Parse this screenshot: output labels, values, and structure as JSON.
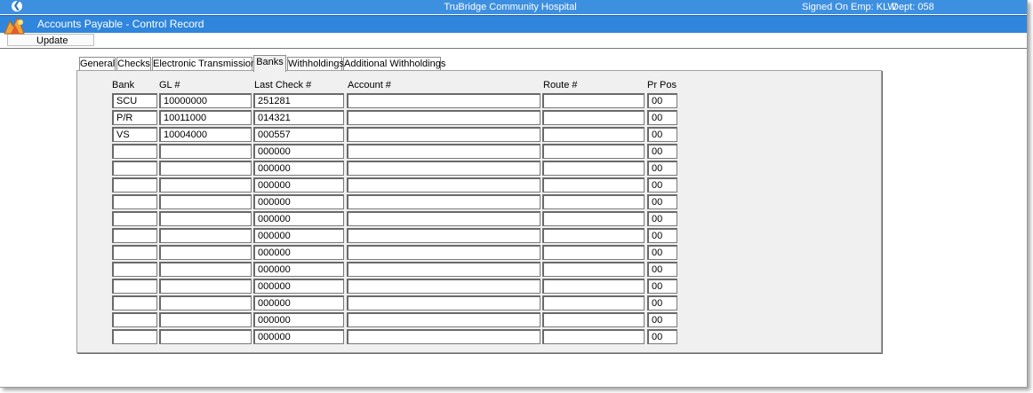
{
  "top_bar": {
    "hospital": "TruBridge Community Hospital",
    "signon": "Signed On Emp: KLW",
    "dept": "Dept: 058"
  },
  "title_bar": {
    "title": "Accounts Payable - Control Record"
  },
  "menu": {
    "update_label": "Update"
  },
  "tabs": [
    {
      "label": "General"
    },
    {
      "label": "Checks"
    },
    {
      "label": "Electronic Transmission"
    },
    {
      "label": "Banks"
    },
    {
      "label": "Withholdings"
    },
    {
      "label": "Additional Withholdings"
    }
  ],
  "active_tab": "Banks",
  "columns": {
    "bank": "Bank",
    "gl": "GL #",
    "last_check": "Last Check #",
    "account": "Account #",
    "route": "Route #",
    "pr_pos": "Pr Pos"
  },
  "rows": [
    {
      "bank": "SCU",
      "gl": "10000000",
      "last_check": "251281",
      "account": "",
      "route": "",
      "pr_pos": "00"
    },
    {
      "bank": "P/R",
      "gl": "10011000",
      "last_check": "014321",
      "account": "",
      "route": "",
      "pr_pos": "00"
    },
    {
      "bank": "VS",
      "gl": "10004000",
      "last_check": "000557",
      "account": "",
      "route": "",
      "pr_pos": "00"
    },
    {
      "bank": "",
      "gl": "",
      "last_check": "000000",
      "account": "",
      "route": "",
      "pr_pos": "00"
    },
    {
      "bank": "",
      "gl": "",
      "last_check": "000000",
      "account": "",
      "route": "",
      "pr_pos": "00"
    },
    {
      "bank": "",
      "gl": "",
      "last_check": "000000",
      "account": "",
      "route": "",
      "pr_pos": "00"
    },
    {
      "bank": "",
      "gl": "",
      "last_check": "000000",
      "account": "",
      "route": "",
      "pr_pos": "00"
    },
    {
      "bank": "",
      "gl": "",
      "last_check": "000000",
      "account": "",
      "route": "",
      "pr_pos": "00"
    },
    {
      "bank": "",
      "gl": "",
      "last_check": "000000",
      "account": "",
      "route": "",
      "pr_pos": "00"
    },
    {
      "bank": "",
      "gl": "",
      "last_check": "000000",
      "account": "",
      "route": "",
      "pr_pos": "00"
    },
    {
      "bank": "",
      "gl": "",
      "last_check": "000000",
      "account": "",
      "route": "",
      "pr_pos": "00"
    },
    {
      "bank": "",
      "gl": "",
      "last_check": "000000",
      "account": "",
      "route": "",
      "pr_pos": "00"
    },
    {
      "bank": "",
      "gl": "",
      "last_check": "000000",
      "account": "",
      "route": "",
      "pr_pos": "00"
    },
    {
      "bank": "",
      "gl": "",
      "last_check": "000000",
      "account": "",
      "route": "",
      "pr_pos": "00"
    },
    {
      "bank": "",
      "gl": "",
      "last_check": "000000",
      "account": "",
      "route": "",
      "pr_pos": "00"
    }
  ],
  "icons": {
    "back": "back-arrow-icon",
    "logo": "app-logo-icon"
  },
  "colors": {
    "top_bar": "#3d8fe0",
    "title_bar": "#2f86dc",
    "panel": "#f0f0f0"
  }
}
